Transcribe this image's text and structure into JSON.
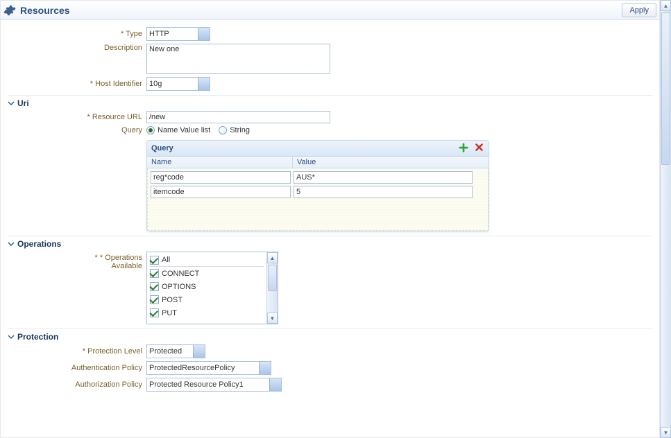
{
  "header": {
    "title": "Resources",
    "apply_label": "Apply"
  },
  "form": {
    "labels": {
      "type": "Type",
      "description": "Description",
      "host_identifier": "Host Identifier",
      "resource_url": "Resource URL",
      "query": "Query",
      "operations_available": "Operations Available",
      "protection_level": "Protection Level",
      "authn_policy": "Authentication Policy",
      "authz_policy": "Authorization Policy"
    },
    "type_value": "HTTP",
    "description_value": "New one",
    "host_identifier_value": "10g",
    "resource_url_value": "/new",
    "query_mode_name_value_list": "Name Value list",
    "query_mode_string": "String"
  },
  "sections": {
    "uri": "Uri",
    "operations": "Operations",
    "protection": "Protection"
  },
  "query_panel": {
    "title": "Query",
    "col_name": "Name",
    "col_value": "Value",
    "rows": [
      {
        "name": "reg*code",
        "value": "AUS*"
      },
      {
        "name": "itemcode",
        "value": "5"
      }
    ]
  },
  "operations": {
    "all_label": "All",
    "items": [
      "CONNECT",
      "OPTIONS",
      "POST",
      "PUT"
    ]
  },
  "protection": {
    "level_value": "Protected",
    "authn_value": "ProtectedResourcePolicy",
    "authz_value": "Protected Resource Policy1"
  }
}
